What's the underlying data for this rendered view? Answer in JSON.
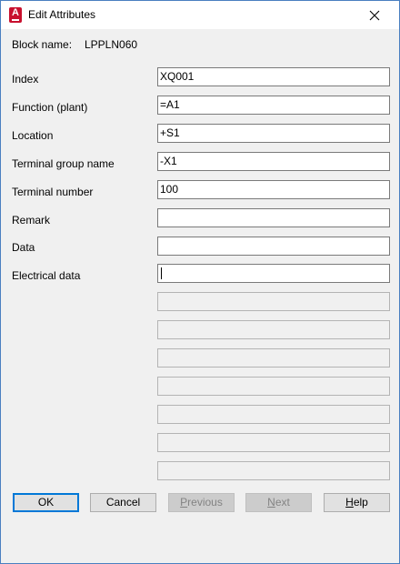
{
  "window": {
    "title": "Edit Attributes",
    "app_icon": "autocad-a-icon",
    "close_icon": "close-icon"
  },
  "block": {
    "label": "Block name:",
    "value": "LPPLN060"
  },
  "attributes": [
    {
      "label": "Index",
      "value": "XQ001"
    },
    {
      "label": "Function (plant)",
      "value": "=A1"
    },
    {
      "label": "Location",
      "value": "+S1"
    },
    {
      "label": "Terminal group name",
      "value": "-X1"
    },
    {
      "label": "Terminal number",
      "value": "100"
    },
    {
      "label": "Remark",
      "value": ""
    },
    {
      "label": "Data",
      "value": ""
    },
    {
      "label": "Electrical data",
      "value": ""
    }
  ],
  "buttons": {
    "ok": "OK",
    "cancel": "Cancel",
    "previous_first": "P",
    "previous_rest": "revious",
    "next_first": "N",
    "next_rest": "ext",
    "help_first": "H",
    "help_rest": "elp"
  }
}
